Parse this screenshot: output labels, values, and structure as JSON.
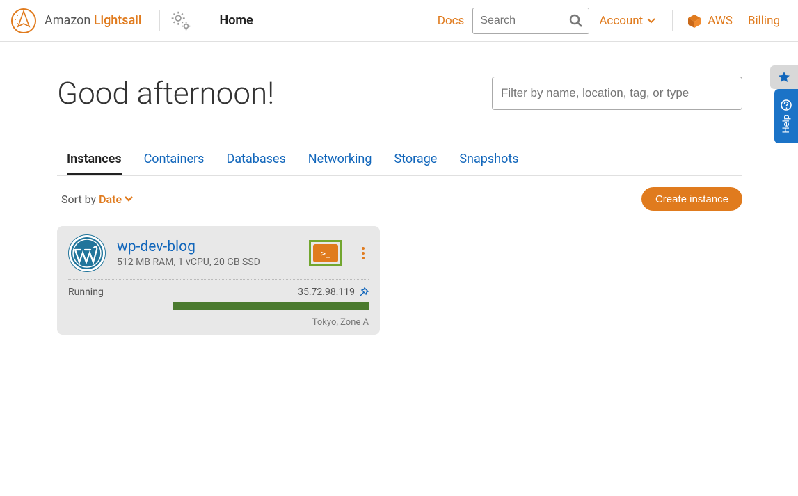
{
  "header": {
    "brand_left": "Amazon",
    "brand_right": "Lightsail",
    "home_label": "Home",
    "docs_label": "Docs",
    "search_placeholder": "Search",
    "account_label": "Account",
    "aws_label": "AWS",
    "billing_label": "Billing"
  },
  "main": {
    "greeting": "Good afternoon!",
    "filter_placeholder": "Filter by name, location, tag, or type",
    "tabs": [
      {
        "label": "Instances",
        "active": true
      },
      {
        "label": "Containers",
        "active": false
      },
      {
        "label": "Databases",
        "active": false
      },
      {
        "label": "Networking",
        "active": false
      },
      {
        "label": "Storage",
        "active": false
      },
      {
        "label": "Snapshots",
        "active": false
      }
    ],
    "sort_prefix": "Sort by",
    "sort_value": "Date",
    "create_label": "Create instance"
  },
  "instance": {
    "name": "wp-dev-blog",
    "specs": "512 MB RAM, 1 vCPU, 20 GB SSD",
    "status": "Running",
    "ip": "35.72.98.119",
    "location": "Tokyo, Zone A",
    "app_icon": "wordpress",
    "ssh_glyph": ">_"
  },
  "help": {
    "label": "Help"
  }
}
